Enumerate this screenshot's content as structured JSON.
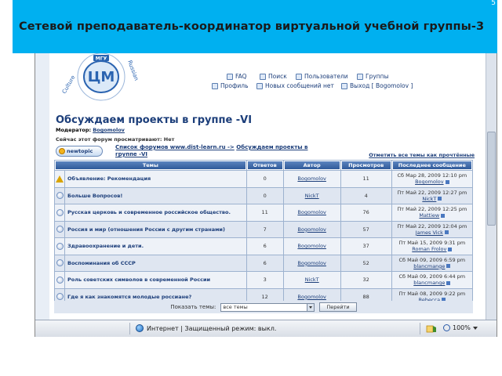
{
  "slide": {
    "title": "Сетевой преподаватель-координатор виртуальной учебной группы-3",
    "corner_glyph": "5"
  },
  "logo": {
    "badge": "МГУ",
    "arc_left": "Culture",
    "arc_right": "Russian"
  },
  "nav": {
    "faq": "FAQ",
    "search": "Поиск",
    "users": "Пользователи",
    "groups": "Группы",
    "profile": "Профиль",
    "messages": "Новых сообщений нет",
    "logout": "Выход [ Bogomolov ]"
  },
  "forum": {
    "title": "Обсуждаем проекты в группе -VI",
    "moderator_label": "Модератор:",
    "moderator_name": "Bogomolov",
    "viewers": "Сейчас этот форум просматривают: Нет",
    "newtopic_label": "newtopic",
    "breadcrumb_prefix": "Список форумов www.dist-learn.ru ->",
    "breadcrumb_current": "Обсуждаем проекты в группе -VI",
    "mark_read": "Отметить все темы как прочтённые"
  },
  "table": {
    "headers": [
      "Темы",
      "Ответов",
      "Автор",
      "Просмотров",
      "Последнее сообщение"
    ],
    "rows": [
      {
        "topic_prefix": "Объявление:",
        "topic": "Рекомендация",
        "replies": "0",
        "author": "Bogomolov",
        "views": "11",
        "last_date": "Сб Мар 28, 2009 12:10 pm",
        "last_user": "Bogomolov"
      },
      {
        "topic_prefix": "",
        "topic": "Больше Вопросов!",
        "replies": "0",
        "author": "NickT",
        "views": "4",
        "last_date": "Пт Май 22, 2009 12:27 pm",
        "last_user": "NickT"
      },
      {
        "topic_prefix": "",
        "topic": "Русская церковь и современное российское общество.",
        "replies": "11",
        "author": "Bogomolov",
        "views": "76",
        "last_date": "Пт Май 22, 2009 12:25 pm",
        "last_user": "Mattiew"
      },
      {
        "topic_prefix": "",
        "topic": "Россия и мир (отношения России с другим странами)",
        "replies": "7",
        "author": "Bogomolov",
        "views": "57",
        "last_date": "Пт Май 22, 2009 12:04 pm",
        "last_user": "James Vick"
      },
      {
        "topic_prefix": "",
        "topic": "Здравоохранение и дети.",
        "replies": "6",
        "author": "Bogomolov",
        "views": "37",
        "last_date": "Пт Май 15, 2009 9:31 pm",
        "last_user": "Roman Frolov"
      },
      {
        "topic_prefix": "",
        "topic": "Воспоминания об СССР",
        "replies": "6",
        "author": "Bogomolov",
        "views": "52",
        "last_date": "Сб Май 09, 2009 6:59 pm",
        "last_user": "blancmange"
      },
      {
        "topic_prefix": "",
        "topic": "Роль советских символов в современной России",
        "replies": "3",
        "author": "NickT",
        "views": "32",
        "last_date": "Сб Май 09, 2009 6:44 pm",
        "last_user": "blancmange"
      },
      {
        "topic_prefix": "",
        "topic": "Где я как знакомятся молодые россиане?",
        "replies": "12",
        "author": "Bogomolov",
        "views": "88",
        "last_date": "Пт Май 08, 2009 9:22 pm",
        "last_user": "Rebecca"
      }
    ],
    "show_label": "Показать темы:",
    "show_value": "все темы",
    "go_label": "Перейти"
  },
  "statusbar": {
    "zone": "Интернет | Защищенный режим: выкл.",
    "zoom": "100%"
  }
}
